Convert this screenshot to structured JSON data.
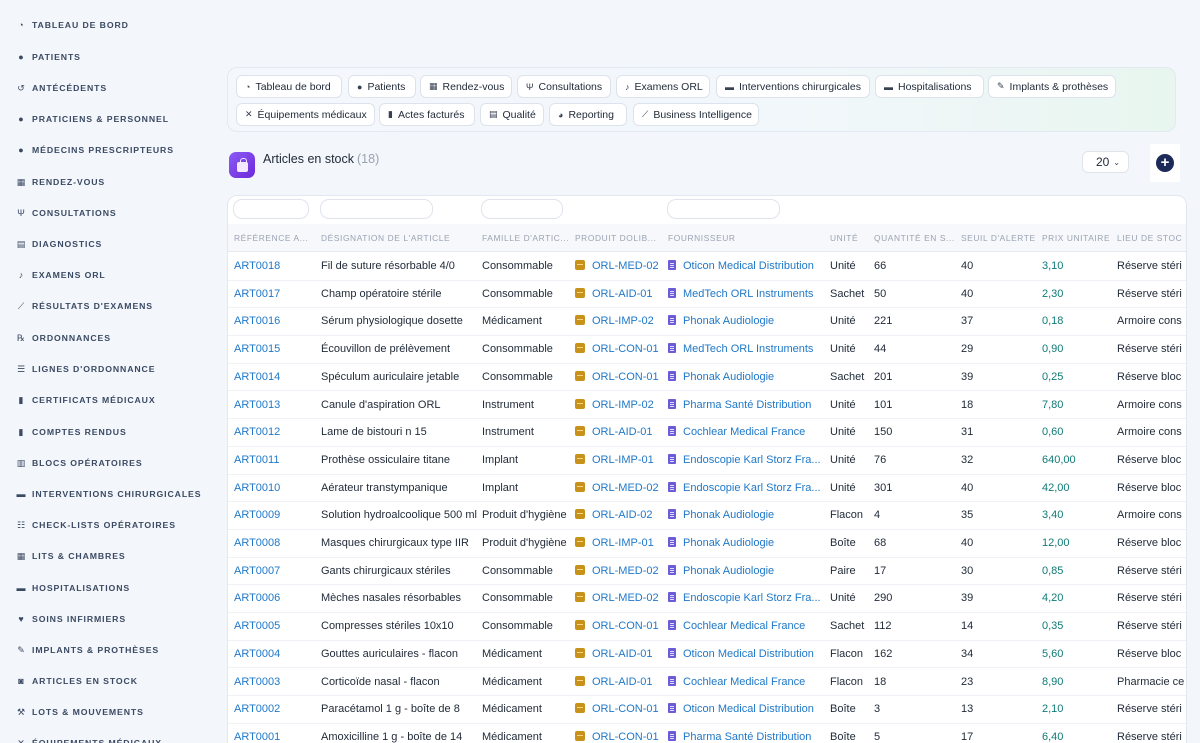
{
  "sidebar": {
    "items": [
      {
        "label": "TABLEAU DE BORD",
        "icon": "dashboard-icon",
        "glyph": "◔"
      },
      {
        "label": "PATIENTS",
        "icon": "user-icon",
        "glyph": "●"
      },
      {
        "label": "ANTÉCÉDENTS",
        "icon": "history-icon",
        "glyph": "↺"
      },
      {
        "label": "PRATICIENS & PERSONNEL",
        "icon": "user-md-icon",
        "glyph": "●"
      },
      {
        "label": "MÉDECINS PRESCRIPTEURS",
        "icon": "user-md-icon",
        "glyph": "●"
      },
      {
        "label": "RENDEZ-VOUS",
        "icon": "calendar-icon",
        "glyph": "▦"
      },
      {
        "label": "CONSULTATIONS",
        "icon": "stethoscope-icon",
        "glyph": "Ψ"
      },
      {
        "label": "DIAGNOSTICS",
        "icon": "clipboard-icon",
        "glyph": "▤"
      },
      {
        "label": "EXAMENS ORL",
        "icon": "ear-icon",
        "glyph": "♪"
      },
      {
        "label": "RÉSULTATS D'EXAMENS",
        "icon": "chart-line-icon",
        "glyph": "⟋"
      },
      {
        "label": "ORDONNANCES",
        "icon": "prescription-icon",
        "glyph": "℞"
      },
      {
        "label": "LIGNES D'ORDONNANCE",
        "icon": "list-icon",
        "glyph": "☰"
      },
      {
        "label": "CERTIFICATS MÉDICAUX",
        "icon": "file-icon",
        "glyph": "▮"
      },
      {
        "label": "COMPTES RENDUS",
        "icon": "file-icon",
        "glyph": "▮"
      },
      {
        "label": "BLOCS OPÉRATOIRES",
        "icon": "hospital-icon",
        "glyph": "▥"
      },
      {
        "label": "INTERVENTIONS CHIRURGICALES",
        "icon": "bed-icon",
        "glyph": "▬"
      },
      {
        "label": "CHECK-LISTS OPÉRATOIRES",
        "icon": "checklist-icon",
        "glyph": "☷"
      },
      {
        "label": "LITS & CHAMBRES",
        "icon": "room-icon",
        "glyph": "▦"
      },
      {
        "label": "HOSPITALISATIONS",
        "icon": "bed-icon",
        "glyph": "▬"
      },
      {
        "label": "SOINS INFIRMIERS",
        "icon": "heart-pulse-icon",
        "glyph": "♥"
      },
      {
        "label": "IMPLANTS & PROTHÈSES",
        "icon": "implant-icon",
        "glyph": "✎"
      },
      {
        "label": "ARTICLES EN STOCK",
        "icon": "boxes-icon",
        "glyph": "◙"
      },
      {
        "label": "LOTS & MOUVEMENTS",
        "icon": "dolly-icon",
        "glyph": "⚒"
      },
      {
        "label": "ÉQUIPEMENTS MÉDICAUX",
        "icon": "tools-icon",
        "glyph": "✕"
      }
    ]
  },
  "quicknav": {
    "items": [
      {
        "label": "Tableau de bord",
        "icon": "dashboard-icon",
        "glyph": "◔"
      },
      {
        "label": "Patients",
        "icon": "user-icon",
        "glyph": "●"
      },
      {
        "label": "Rendez-vous",
        "icon": "calendar-icon",
        "glyph": "▦"
      },
      {
        "label": "Consultations",
        "icon": "stethoscope-icon",
        "glyph": "Ψ"
      },
      {
        "label": "Examens ORL",
        "icon": "ear-icon",
        "glyph": "♪"
      },
      {
        "label": "Interventions chirurgicales",
        "icon": "bed-icon",
        "glyph": "▬"
      },
      {
        "label": "Hospitalisations",
        "icon": "bed-icon",
        "glyph": "▬"
      },
      {
        "label": "Implants & prothèses",
        "icon": "implant-icon",
        "glyph": "✎"
      },
      {
        "label": "Équipements médicaux",
        "icon": "tools-icon",
        "glyph": "✕"
      },
      {
        "label": "Actes facturés",
        "icon": "file-icon",
        "glyph": "▮"
      },
      {
        "label": "Qualité",
        "icon": "clipboard-check-icon",
        "glyph": "▤"
      },
      {
        "label": "Reporting",
        "icon": "pie-chart-icon",
        "glyph": "◕"
      },
      {
        "label": "Business Intelligence",
        "icon": "chart-line-icon",
        "glyph": "⟋"
      }
    ]
  },
  "header": {
    "title": "Articles en stock",
    "count": "(18)",
    "page_size": "20"
  },
  "table": {
    "columns": [
      "RÉFÉRENCE A...",
      "DÉSIGNATION DE L'ARTICLE",
      "FAMILLE D'ARTIC...",
      "PRODUIT DOLIB...",
      "FOURNISSEUR",
      "UNITÉ",
      "QUANTITÉ EN S...",
      "SEUIL D'ALERTE",
      "PRIX UNITAIRE",
      "LIEU DE STOC"
    ],
    "rows": [
      [
        "ART0018",
        "Fil de suture résorbable 4/0",
        "Consommable",
        "ORL-MED-02",
        "Oticon Medical Distribution",
        "Unité",
        "66",
        "40",
        "3,10",
        "Réserve stéri"
      ],
      [
        "ART0017",
        "Champ opératoire stérile",
        "Consommable",
        "ORL-AID-01",
        "MedTech ORL Instruments",
        "Sachet",
        "50",
        "40",
        "2,30",
        "Réserve stéri"
      ],
      [
        "ART0016",
        "Sérum physiologique dosette",
        "Médicament",
        "ORL-IMP-02",
        "Phonak Audiologie",
        "Unité",
        "221",
        "37",
        "0,18",
        "Armoire cons"
      ],
      [
        "ART0015",
        "Écouvillon de prélèvement",
        "Consommable",
        "ORL-CON-01",
        "MedTech ORL Instruments",
        "Unité",
        "44",
        "29",
        "0,90",
        "Réserve stéri"
      ],
      [
        "ART0014",
        "Spéculum auriculaire jetable",
        "Consommable",
        "ORL-CON-01",
        "Phonak Audiologie",
        "Sachet",
        "201",
        "39",
        "0,25",
        "Réserve bloc"
      ],
      [
        "ART0013",
        "Canule d'aspiration ORL",
        "Instrument",
        "ORL-IMP-02",
        "Pharma Santé Distribution",
        "Unité",
        "101",
        "18",
        "7,80",
        "Armoire cons"
      ],
      [
        "ART0012",
        "Lame de bistouri n 15",
        "Instrument",
        "ORL-AID-01",
        "Cochlear Medical France",
        "Unité",
        "150",
        "31",
        "0,60",
        "Armoire cons"
      ],
      [
        "ART0011",
        "Prothèse ossiculaire titane",
        "Implant",
        "ORL-IMP-01",
        "Endoscopie Karl Storz Fra...",
        "Unité",
        "76",
        "32",
        "640,00",
        "Réserve bloc"
      ],
      [
        "ART0010",
        "Aérateur transtympanique",
        "Implant",
        "ORL-MED-02",
        "Endoscopie Karl Storz Fra...",
        "Unité",
        "301",
        "40",
        "42,00",
        "Réserve bloc"
      ],
      [
        "ART0009",
        "Solution hydroalcoolique 500 ml",
        "Produit d'hygiène",
        "ORL-AID-02",
        "Phonak Audiologie",
        "Flacon",
        "4",
        "35",
        "3,40",
        "Armoire cons"
      ],
      [
        "ART0008",
        "Masques chirurgicaux type IIR",
        "Produit d'hygiène",
        "ORL-IMP-01",
        "Phonak Audiologie",
        "Boîte",
        "68",
        "40",
        "12,00",
        "Réserve bloc"
      ],
      [
        "ART0007",
        "Gants chirurgicaux stériles",
        "Consommable",
        "ORL-MED-02",
        "Phonak Audiologie",
        "Paire",
        "17",
        "30",
        "0,85",
        "Réserve stéri"
      ],
      [
        "ART0006",
        "Mèches nasales résorbables",
        "Consommable",
        "ORL-MED-02",
        "Endoscopie Karl Storz Fra...",
        "Unité",
        "290",
        "39",
        "4,20",
        "Réserve stéri"
      ],
      [
        "ART0005",
        "Compresses stériles 10x10",
        "Consommable",
        "ORL-CON-01",
        "Cochlear Medical France",
        "Sachet",
        "112",
        "14",
        "0,35",
        "Réserve stéri"
      ],
      [
        "ART0004",
        "Gouttes auriculaires - flacon",
        "Médicament",
        "ORL-AID-01",
        "Oticon Medical Distribution",
        "Flacon",
        "162",
        "34",
        "5,60",
        "Réserve bloc"
      ],
      [
        "ART0003",
        "Corticoïde nasal - flacon",
        "Médicament",
        "ORL-AID-01",
        "Cochlear Medical France",
        "Flacon",
        "18",
        "23",
        "8,90",
        "Pharmacie ce"
      ],
      [
        "ART0002",
        "Paracétamol 1 g - boîte de 8",
        "Médicament",
        "ORL-CON-01",
        "Oticon Medical Distribution",
        "Boîte",
        "3",
        "13",
        "2,10",
        "Réserve stéri"
      ],
      [
        "ART0001",
        "Amoxicilline 1 g - boîte de 14",
        "Médicament",
        "ORL-CON-01",
        "Pharma Santé Distribution",
        "Boîte",
        "5",
        "17",
        "6,40",
        "Réserve stéri"
      ]
    ]
  },
  "colors": {
    "link": "#1f78c8",
    "price": "#0f7b76",
    "accent": "#6d28d9",
    "add_button": "#1c2a59"
  }
}
